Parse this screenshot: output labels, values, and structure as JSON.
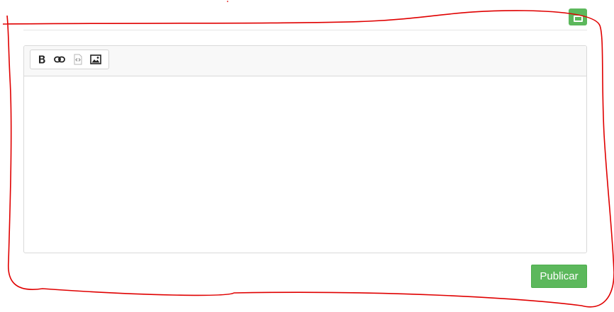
{
  "editor": {
    "toolbar": {
      "tools": [
        {
          "name": "bold",
          "icon": "bold-icon"
        },
        {
          "name": "link",
          "icon": "link-icon"
        },
        {
          "name": "code",
          "icon": "code-icon"
        },
        {
          "name": "image",
          "icon": "image-icon"
        }
      ]
    },
    "content": ""
  },
  "actions": {
    "publish_label": "Publicar",
    "top_button_icon": "folder-icon"
  },
  "colors": {
    "accent_green": "#5cb85c",
    "annotation_red": "#e00000",
    "border": "#d9d9d9",
    "toolbar_bg": "#f8f8f8"
  }
}
